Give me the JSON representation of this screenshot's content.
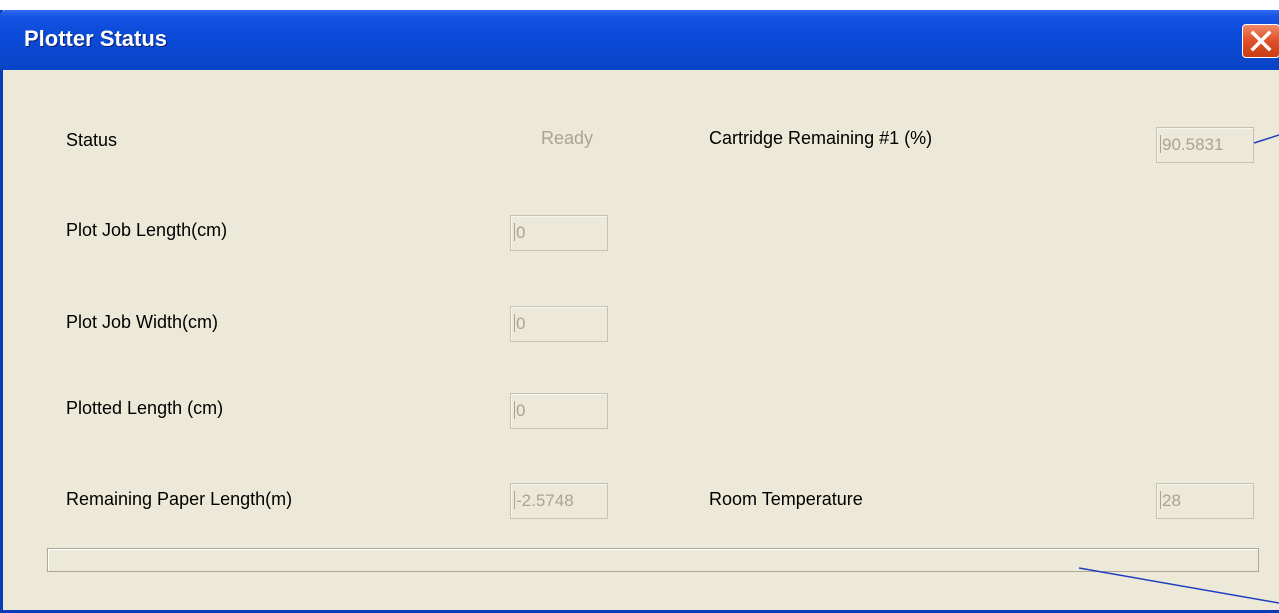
{
  "window": {
    "title": "Plotter Status",
    "close_icon": "close-icon"
  },
  "status": {
    "label": "Status",
    "value": "Ready"
  },
  "fields": {
    "plot_job_length": {
      "label": "Plot Job Length(cm)",
      "value": "0"
    },
    "plot_job_width": {
      "label": "Plot Job Width(cm)",
      "value": "0"
    },
    "plotted_length": {
      "label": "Plotted Length (cm)",
      "value": "0"
    },
    "remaining_paper_length": {
      "label": "Remaining Paper Length(m)",
      "value": "-2.5748"
    },
    "cartridge_remaining_1": {
      "label": "Cartridge Remaining #1 (%)",
      "value": "90.5831"
    },
    "room_temperature": {
      "label": "Room Temperature",
      "value": "28"
    }
  },
  "progress": {
    "percent": 0
  },
  "colors": {
    "titlebar": "#0a4ad8",
    "window_background": "#ece9d8",
    "close_button": "#e0532b",
    "annotation_line": "#1f3fbf"
  }
}
